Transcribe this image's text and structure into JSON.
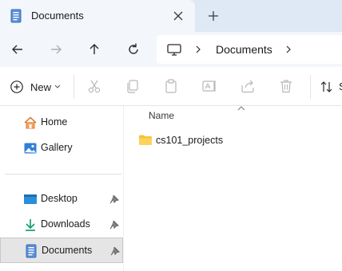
{
  "tab": {
    "title": "Documents",
    "close_icon": "close-icon",
    "new_tab_icon": "plus-icon"
  },
  "nav": {
    "back_icon": "arrow-left-icon",
    "forward_icon": "arrow-right-icon",
    "up_icon": "arrow-up-icon",
    "refresh_icon": "refresh-icon",
    "breadcrumb": {
      "root_icon": "computer-icon",
      "location": "Documents"
    }
  },
  "commands": {
    "new_label": "New",
    "sort_label": "S",
    "icons": [
      "cut-icon",
      "copy-icon",
      "paste-icon",
      "rename-icon",
      "share-icon",
      "delete-icon"
    ]
  },
  "sidebar": {
    "items": [
      {
        "label": "Home",
        "icon": "home-icon",
        "pinned": false
      },
      {
        "label": "Gallery",
        "icon": "gallery-icon",
        "pinned": false
      },
      {
        "label": "Desktop",
        "icon": "desktop-icon",
        "pinned": true
      },
      {
        "label": "Downloads",
        "icon": "downloads-icon",
        "pinned": true
      },
      {
        "label": "Documents",
        "icon": "documents-icon",
        "pinned": true,
        "selected": true
      }
    ]
  },
  "content": {
    "column_header": "Name",
    "files": [
      {
        "name": "cs101_projects",
        "type": "folder"
      }
    ]
  },
  "colors": {
    "accent": "#0067c0",
    "folder": "#f8c33a",
    "tabstrip": "#dfe9f5"
  }
}
